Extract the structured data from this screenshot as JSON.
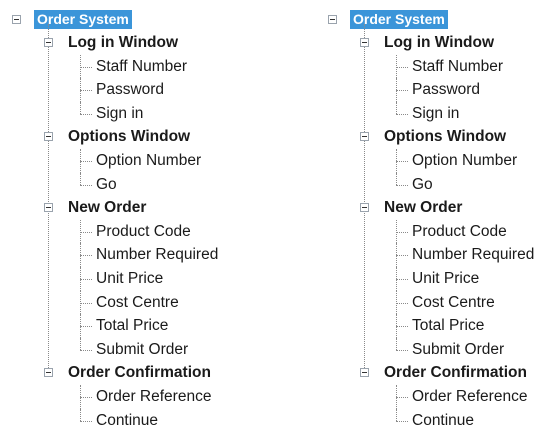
{
  "trees": [
    {
      "root": "Order System",
      "groups": [
        {
          "label": "Log in Window",
          "items": [
            "Staff Number",
            "Password",
            "Sign in"
          ]
        },
        {
          "label": "Options Window",
          "items": [
            "Option Number",
            "Go"
          ]
        },
        {
          "label": "New Order",
          "items": [
            "Product Code",
            "Number Required",
            "Unit Price",
            "Cost Centre",
            "Total Price",
            "Submit Order"
          ]
        },
        {
          "label": "Order Confirmation",
          "items": [
            "Order Reference",
            "Continue"
          ]
        }
      ]
    },
    {
      "root": "Order System",
      "groups": [
        {
          "label": "Log in Window",
          "items": [
            "Staff Number",
            "Password",
            "Sign in"
          ]
        },
        {
          "label": "Options Window",
          "items": [
            "Option Number",
            "Go"
          ]
        },
        {
          "label": "New Order",
          "items": [
            "Product Code",
            "Number Required",
            "Unit Price",
            "Cost Centre",
            "Total Price",
            "Submit Order"
          ]
        },
        {
          "label": "Order Confirmation",
          "items": [
            "Order Reference",
            "Continue"
          ]
        }
      ]
    }
  ],
  "icons": {
    "collapse": "minus-box-icon"
  },
  "colors": {
    "selection": "#3b95d9",
    "connector": "#8a8a8a"
  }
}
